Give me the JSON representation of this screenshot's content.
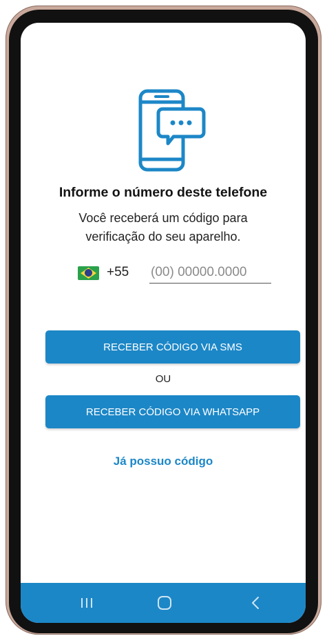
{
  "screen": {
    "title": "Informe o número deste telefone",
    "subtitle": "Você receberá um código para verificação do seu aparelho."
  },
  "phone": {
    "flag": "brazil-flag-icon",
    "country_code": "+55",
    "placeholder": "(00) 00000.0000",
    "value": ""
  },
  "buttons": {
    "sms_label": "RECEBER CÓDIGO VIA SMS",
    "or_label": "OU",
    "whatsapp_label": "RECEBER CÓDIGO VIA WHATSAPP",
    "have_code_label": "Já possuo código"
  },
  "navbar": {
    "items": [
      "recents-icon",
      "home-icon",
      "back-icon"
    ]
  },
  "colors": {
    "accent": "#1c87c7",
    "text": "#141414",
    "flag_green": "#2aa14a",
    "flag_yellow": "#f6d63a",
    "flag_blue": "#2b3f8d"
  }
}
